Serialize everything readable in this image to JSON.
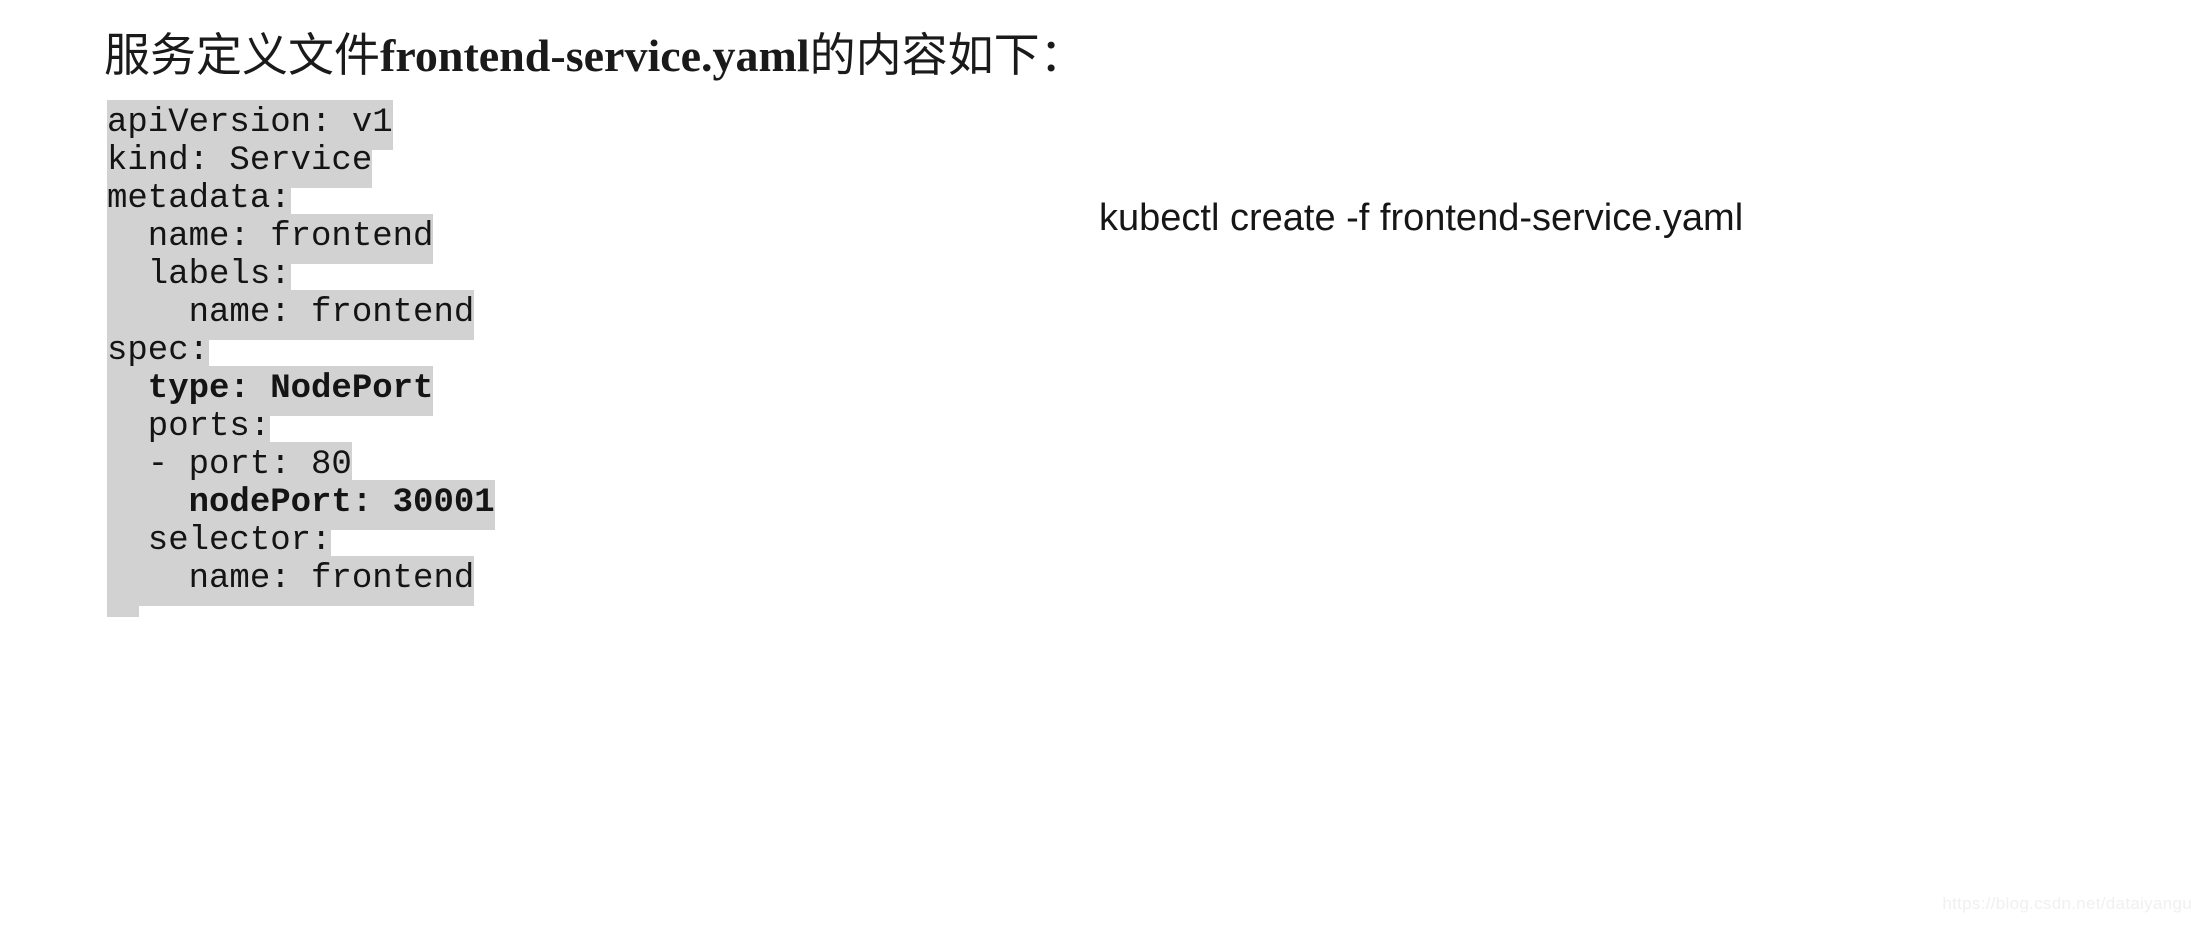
{
  "heading": {
    "prefix": "服务定义文件",
    "filename": "frontend-service.yaml",
    "suffix": "的内容如下："
  },
  "code_block": {
    "language": "yaml",
    "highlight_color": "#d2d2d2",
    "text_color": "#141414",
    "lines": [
      {
        "text": "apiVersion: v1",
        "bold": false
      },
      {
        "text": "kind: Service",
        "bold": false
      },
      {
        "text": "metadata:",
        "bold": false
      },
      {
        "text": "  name: frontend",
        "bold": false
      },
      {
        "text": "  labels:",
        "bold": false
      },
      {
        "text": "    name: frontend",
        "bold": false
      },
      {
        "text": "spec:",
        "bold": false
      },
      {
        "text": "  type: NodePort",
        "bold": true
      },
      {
        "text": "  ports:",
        "bold": false
      },
      {
        "text": "  - port: 80",
        "bold": false
      },
      {
        "text": "    nodePort: 30001",
        "bold": true
      },
      {
        "text": "  selector:",
        "bold": false
      },
      {
        "text": "    name: frontend",
        "bold": false
      }
    ]
  },
  "command": {
    "text": "kubectl create -f frontend-service.yaml"
  },
  "watermark": {
    "text": "https://blog.csdn.net/dataiyangu"
  }
}
